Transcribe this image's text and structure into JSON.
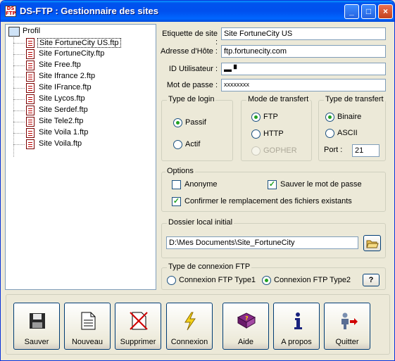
{
  "window": {
    "title": "DS-FTP : Gestionnaire des sites",
    "icon_text": "DS FTP",
    "minimize": "_",
    "maximize": "□",
    "close": "×"
  },
  "tree": {
    "root": "Profil",
    "items": [
      {
        "label": "Site FortuneCity US.ftp",
        "selected": true
      },
      {
        "label": "Site FortuneCity.ftp"
      },
      {
        "label": "Site Free.ftp"
      },
      {
        "label": "Site Ifrance 2.ftp"
      },
      {
        "label": "Site IFrance.ftp"
      },
      {
        "label": "Site Lycos.ftp"
      },
      {
        "label": "Site Serdef.ftp"
      },
      {
        "label": "Site Tele2.ftp"
      },
      {
        "label": "Site Voila 1.ftp"
      },
      {
        "label": "Site Voila.ftp"
      }
    ]
  },
  "form": {
    "etiquette_label": "Etiquette de site :",
    "etiquette_value": "Site FortuneCity US",
    "hote_label": "Adresse d'Hôte :",
    "hote_value": "ftp.fortunecity.com",
    "id_label": "ID Utilisateur :",
    "id_value": "▬ ▘",
    "mdp_label": "Mot de passe :",
    "mdp_value": "xxxxxxxx"
  },
  "login": {
    "title": "Type de login",
    "options": [
      "Passif",
      "Actif"
    ],
    "selected": "Passif"
  },
  "mode": {
    "title": "Mode de transfert",
    "options": [
      "FTP",
      "HTTP",
      "GOPHER"
    ],
    "selected": "FTP",
    "disabled": [
      "GOPHER"
    ]
  },
  "transfer": {
    "title": "Type de transfert",
    "options": [
      "Binaire",
      "ASCII"
    ],
    "selected": "Binaire",
    "port_label": "Port :",
    "port_value": "21"
  },
  "options": {
    "title": "Options",
    "anonyme": "Anonyme",
    "anonyme_checked": false,
    "sauver": "Sauver le mot de passe",
    "sauver_checked": true,
    "confirmer": "Confirmer le remplacement des fichiers existants",
    "confirmer_checked": true
  },
  "dossier": {
    "title": "Dossier local initial",
    "value": "D:\\Mes Documents\\Site_FortuneCity",
    "browse_icon": "open-folder-icon"
  },
  "connexion_type": {
    "title": "Type de connexion FTP",
    "options": [
      "Connexion FTP Type1",
      "Connexion FTP Type2"
    ],
    "selected": "Connexion FTP Type2",
    "help": "?"
  },
  "buttons": [
    {
      "label": "Sauver",
      "icon": "floppy-disk-icon"
    },
    {
      "label": "Nouveau",
      "icon": "new-document-icon"
    },
    {
      "label": "Supprimer",
      "icon": "delete-document-icon"
    },
    {
      "label": "Connexion",
      "icon": "lightning-icon"
    },
    {
      "label": "Aide",
      "icon": "help-book-icon"
    },
    {
      "label": "A propos",
      "icon": "info-icon"
    },
    {
      "label": "Quitter",
      "icon": "exit-icon"
    }
  ]
}
